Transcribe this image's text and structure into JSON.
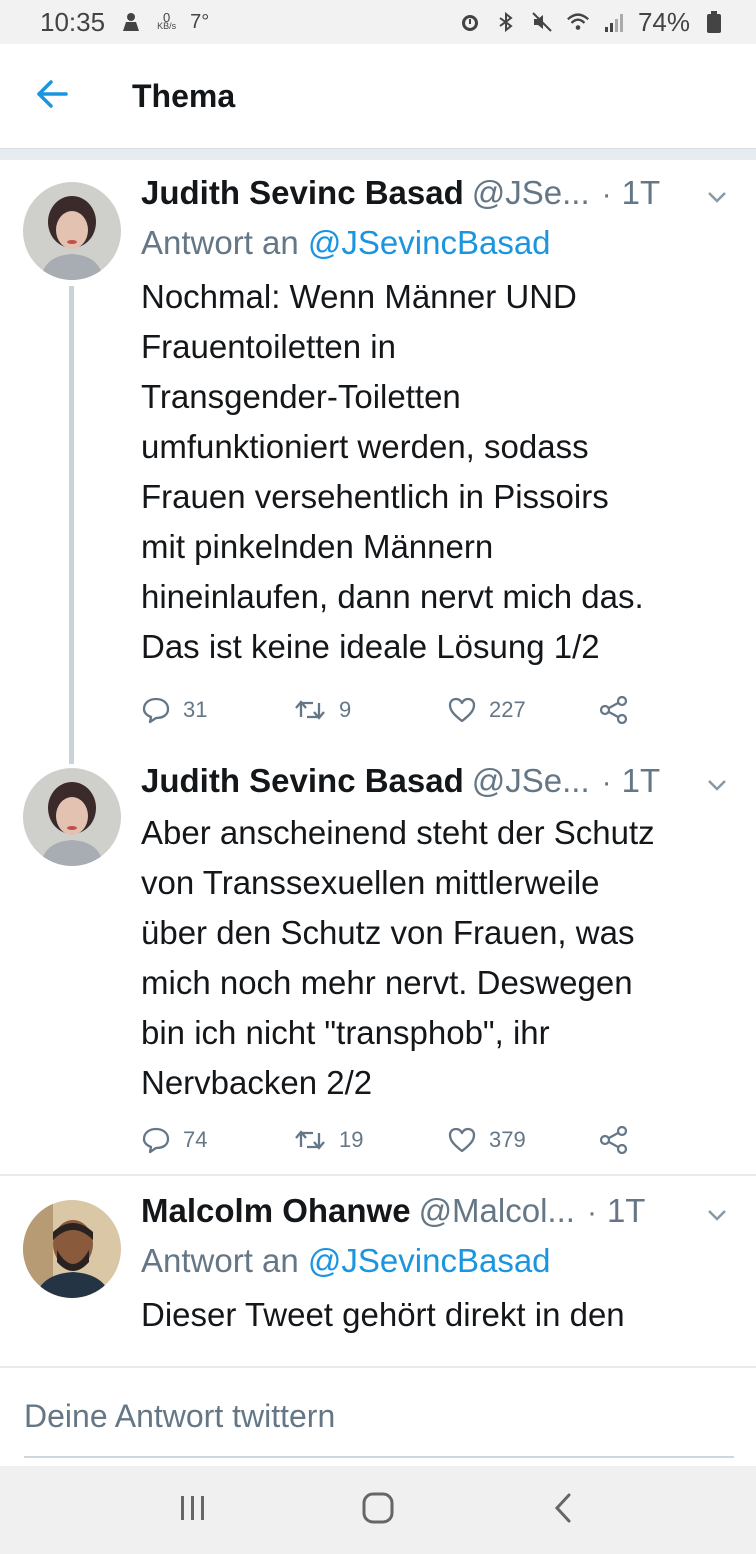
{
  "status_bar": {
    "time": "10:35",
    "net_speed_value": "0",
    "net_speed_unit": "KB/s",
    "temperature": "7°",
    "battery": "74%",
    "icons": [
      "person-icon",
      "alarm-icon",
      "bluetooth-icon",
      "mute-icon",
      "wifi-icon",
      "signal-icon",
      "battery-icon"
    ]
  },
  "header": {
    "title": "Thema",
    "back_icon": "arrow-left-icon"
  },
  "tweets": [
    {
      "name": "Judith Sevinc Basad",
      "handle": "@JSe...",
      "dot": "·",
      "time": "1T",
      "reply_prefix": "Antwort an",
      "reply_mention": "@JSevincBasad",
      "text": "Nochmal: Wenn Männer UND\nFrauentoiletten in\nTransgender-Toiletten\numfunktioniert werden, sodass\nFrauen versehentlich in Pissoirs\nmit pinkelnden Männern\nhineinlaufen, dann nervt mich das.\nDas ist keine ideale Lösung 1/2",
      "replies": "31",
      "retweets": "9",
      "likes": "227"
    },
    {
      "name": "Judith Sevinc Basad",
      "handle": "@JSe...",
      "dot": "·",
      "time": "1T",
      "text": "Aber anscheinend steht der Schutz\nvon Transsexuellen mittlerweile\nüber den Schutz von Frauen, was\nmich noch mehr nervt. Deswegen\nbin ich nicht \"transphob\", ihr\nNervbacken 2/2",
      "replies": "74",
      "retweets": "19",
      "likes": "379"
    },
    {
      "name": "Malcolm Ohanwe",
      "handle": "@Malcol...",
      "dot": "·",
      "time": "1T",
      "reply_prefix": "Antwort an",
      "reply_mention": "@JSevincBasad",
      "text": "Dieser Tweet gehört direkt in den"
    }
  ],
  "composer": {
    "placeholder": "Deine Antwort twittern"
  },
  "colors": {
    "accent": "#1b95e0",
    "secondary_text": "#657786",
    "primary_text": "#14171a",
    "divider": "#e6ecf0"
  }
}
